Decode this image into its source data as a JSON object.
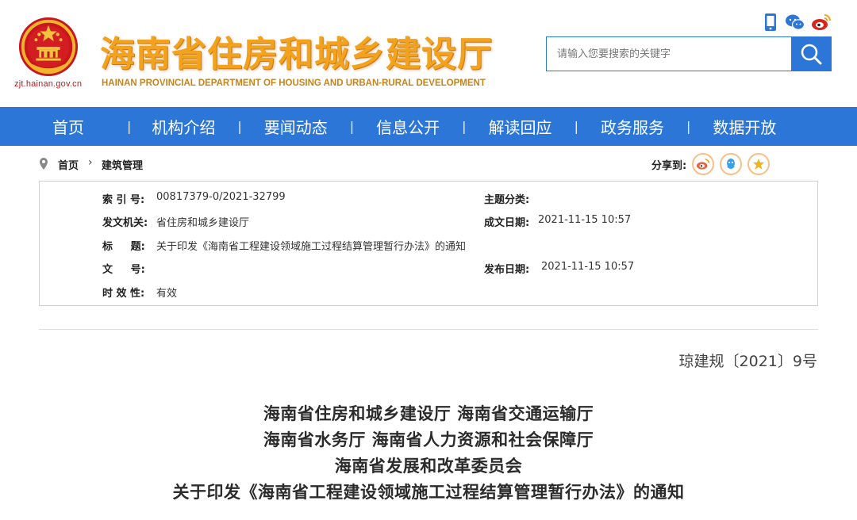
{
  "header": {
    "site_title": "海南省住房和城乡建设厅",
    "site_title_en": "HAINAN PROVINCIAL DEPARTMENT OF HOUSING AND URBAN-RURAL DEVELOPMENT",
    "domain": "zjt.hainan.gov.cn",
    "icons": [
      "mobile-icon",
      "wechat-icon",
      "weibo-icon"
    ],
    "search_placeholder": "请输入您要搜索的关键字",
    "brand_color": "#2b76d6",
    "title_color": "#f2a21c"
  },
  "nav": {
    "items": [
      "首页",
      "机构介绍",
      "要闻动态",
      "信息公开",
      "解读回应",
      "政务服务",
      "数据开放"
    ],
    "separator": "|"
  },
  "breadcrumb": {
    "home": "首页",
    "arrow": "›",
    "current": "建筑管理"
  },
  "share": {
    "label": "分享到:",
    "icons": [
      "weibo-share-icon",
      "qq-share-icon",
      "qzone-share-icon"
    ]
  },
  "info": {
    "index_label": "索 引 号:",
    "index_value": "00817379-0/2021-32799",
    "topic_label": "主题分类:",
    "topic_value": "",
    "issuer_label": "发文机关:",
    "issuer_value": "省住房和城乡建设厅",
    "created_label": "成文日期:",
    "created_value": "2021-11-15 10:57",
    "title_label": "标     题:",
    "title_value": "关于印发《海南省工程建设领域施工过程结算管理暂行办法》的通知",
    "docno_label": "文     号:",
    "docno_value": "",
    "published_label": "发布日期:",
    "published_value": "2021-11-15 10:57",
    "validity_label": "时 效 性:",
    "validity_value": "有效"
  },
  "document": {
    "number": "琼建规〔2021〕9号",
    "heading_lines": [
      "海南省住房和城乡建设厅  海南省交通运输厅",
      "海南省水务厅  海南省人力资源和社会保障厅",
      "海南省发展和改革委员会",
      "关于印发《海南省工程建设领域施工过程结算管理暂行办法》的通知"
    ]
  }
}
